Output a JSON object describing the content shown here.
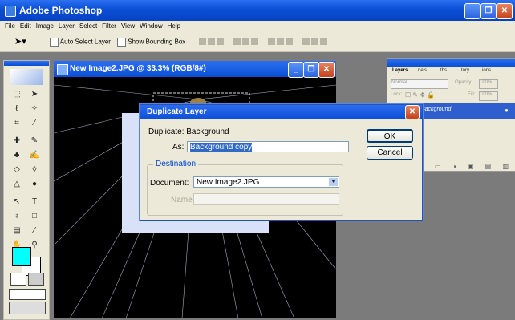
{
  "app": {
    "title": "Adobe Photoshop",
    "minimize_glyph": "_",
    "restore_glyph": "❐",
    "close_glyph": "✕"
  },
  "menu": [
    "File",
    "Edit",
    "Image",
    "Layer",
    "Select",
    "Filter",
    "View",
    "Window",
    "Help"
  ],
  "options": {
    "auto_select": "Auto Select Layer",
    "show_bbox": "Show Bounding Box"
  },
  "document": {
    "title": "New Image2.JPG @ 33.3% (RGB/8#)"
  },
  "layers_panel": {
    "tabs": [
      "Layers",
      "nels",
      "ths",
      "tory",
      "ions"
    ],
    "blend_mode": "Normal",
    "opacity_label": "Opacity:",
    "opacity_value": "100%",
    "lock_label": "Lock:",
    "fill_label": "Fill:",
    "fill_value": "100%",
    "layer_name": "Background"
  },
  "dialog": {
    "title": "Duplicate Layer",
    "duplicate_label": "Duplicate: Background",
    "as_label": "As:",
    "as_value": "Background copy",
    "ok_label": "OK",
    "cancel_label": "Cancel",
    "destination_label": "Destination",
    "document_label": "Document:",
    "document_value": "New Image2.JPG",
    "name_label": "Name:"
  },
  "colors": {
    "foreground": "#00ffff",
    "background": "#ffffff",
    "xp_blue": "#0a4fd4"
  }
}
